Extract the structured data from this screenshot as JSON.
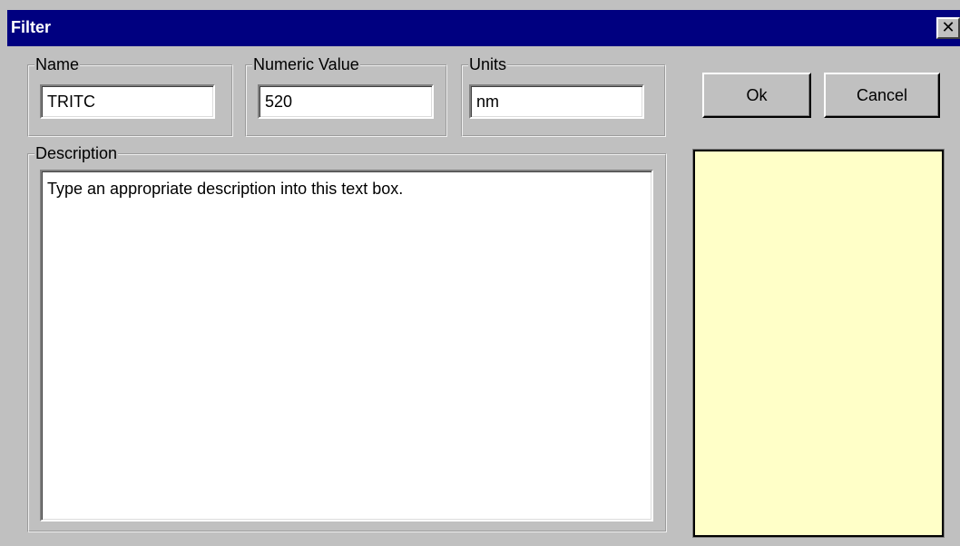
{
  "window": {
    "title": "Filter",
    "close_glyph": "✕"
  },
  "fields": {
    "name": {
      "label": "Name",
      "value": "TRITC"
    },
    "numeric_value": {
      "label": "Numeric Value",
      "value": "520"
    },
    "units": {
      "label": "Units",
      "value": "nm"
    },
    "description": {
      "label": "Description",
      "value": "Type an appropriate description into this text box."
    }
  },
  "buttons": {
    "ok_label": "Ok",
    "cancel_label": "Cancel"
  },
  "colors": {
    "titlebar": "#000080",
    "dialog_face": "#c0c0c0",
    "preview_panel": "#ffffc8"
  }
}
